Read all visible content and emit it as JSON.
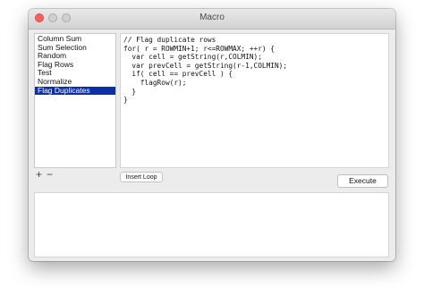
{
  "window": {
    "title": "Macro"
  },
  "macro_list": {
    "items": [
      "Column Sum",
      "Sum Selection",
      "Random",
      "Flag Rows",
      "Test",
      "Normalize",
      "Flag Duplicates"
    ],
    "selected": "Flag Duplicates"
  },
  "editor": {
    "lines": [
      "// Flag duplicate rows",
      "for( r = ROWMIN+1; r<=ROWMAX; ++r) {",
      "  var cell = getString(r,COLMIN);",
      "  var prevCell = getString(r-1,COLMIN);",
      "  if( cell == prevCell ) {",
      "    flagRow(r);",
      "  }",
      "}"
    ]
  },
  "toolbar": {
    "add_label": "+",
    "remove_label": "−",
    "insert_loop_label": "Insert Loop",
    "execute_label": "Execute"
  },
  "output": {
    "text": ""
  },
  "colors": {
    "selection": "#0b2fa6",
    "close_light": "#fc615d"
  }
}
